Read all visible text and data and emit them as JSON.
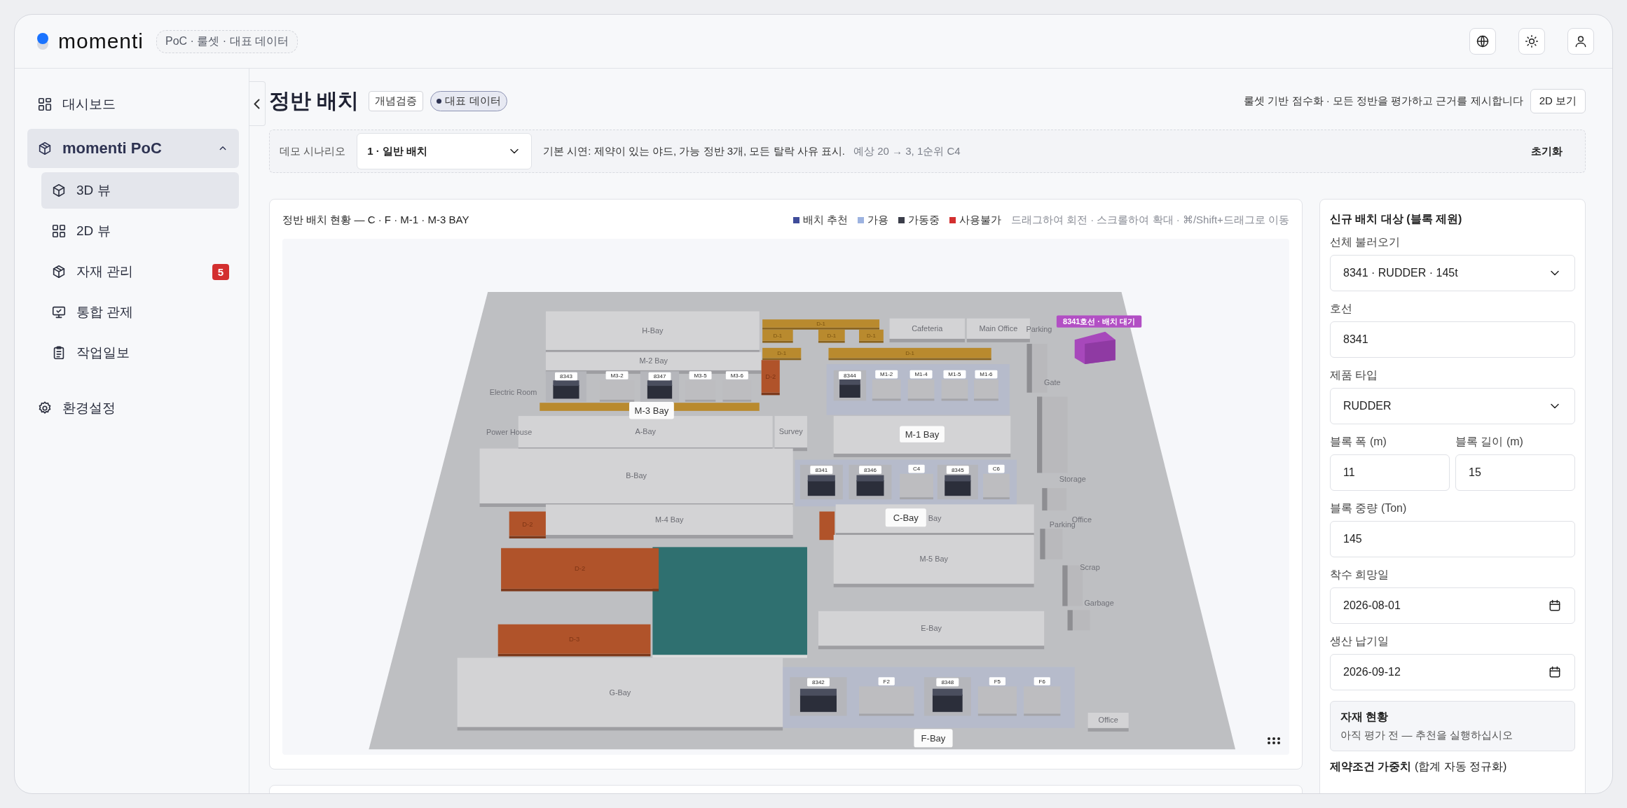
{
  "brand": {
    "name": "momenti",
    "tag": "PoC · 룰셋 · 대표 데이터"
  },
  "top_actions": [
    {
      "kind": "globe"
    },
    {
      "kind": "theme"
    },
    {
      "kind": "user"
    }
  ],
  "sidebar": {
    "items": [
      {
        "kind": "link",
        "label": "대시보드",
        "selected": false
      },
      {
        "kind": "group",
        "label": "momenti PoC",
        "expanded": true,
        "selected": true,
        "children": [
          {
            "label": "3D 뷰",
            "selected": true
          },
          {
            "label": "2D 뷰",
            "selected": false
          },
          {
            "label": "자재 관리",
            "selected": false,
            "badge": "5"
          },
          {
            "label": "통합 관제",
            "selected": false
          },
          {
            "label": "작업일보",
            "selected": false
          }
        ]
      },
      {
        "kind": "link",
        "label": "환경설정",
        "selected": false
      }
    ]
  },
  "page": {
    "title": "정반 배치",
    "tags": [
      {
        "kind": "plain",
        "label": "개념검증"
      },
      {
        "kind": "dot",
        "label": "대표 데이터"
      }
    ],
    "description": "룰셋 기반 점수화 · 모든 정반을 평가하고 근거를 제시합니다",
    "button": "2D 보기"
  },
  "scenario": {
    "label": "데모 시나리오",
    "value": "1 · 일반 배치",
    "description": "기본 시연: 제약이 있는 야드, 가능 정반 3개, 모든 탈락 사유 표시.",
    "expectation": "예상 20 → 3, 1순위 C4",
    "reset": "초기화"
  },
  "view": {
    "title": "정반 배치 현황 — C · F · M-1 · M-3 BAY",
    "legend": [
      {
        "label": "배치 추천",
        "color": "#3f4c9a"
      },
      {
        "label": "가용",
        "color": "#9db3e0"
      },
      {
        "label": "가동중",
        "color": "#3b3e4a"
      },
      {
        "label": "사용불가",
        "color": "#d32f2f"
      }
    ],
    "hint": "드래그하여 회전 · 스크롤하여 확대 · ⌘/Shift+드래그로 이동",
    "map": {
      "areas": [
        {
          "label": "H-Bay"
        },
        {
          "label": "D-1"
        },
        {
          "label": "D-1"
        },
        {
          "label": "D-1"
        },
        {
          "label": "D-1"
        },
        {
          "label": "Cafeteria"
        },
        {
          "label": "Main Office"
        },
        {
          "label": "Parking"
        },
        {
          "label": "M-2 Bay"
        },
        {
          "label": "D-1"
        },
        {
          "label": "D-1"
        },
        {
          "label": "D-2"
        },
        {
          "label": "Electric Room"
        },
        {
          "label": "Gate"
        },
        {
          "label": "M-3 Bay"
        },
        {
          "label": "Power House"
        },
        {
          "label": "A-Bay"
        },
        {
          "label": "Survey"
        },
        {
          "label": "M-1 Bay"
        },
        {
          "label": "B-Bay"
        },
        {
          "label": "Storage"
        },
        {
          "label": "D-2"
        },
        {
          "label": "M-4 Bay"
        },
        {
          "label": "C-Bay"
        },
        {
          "label": "Bay"
        },
        {
          "label": "Office"
        },
        {
          "label": "Parking"
        },
        {
          "label": "M-5 Bay"
        },
        {
          "label": "D-2"
        },
        {
          "label": "Scrap"
        },
        {
          "label": "Garbage"
        },
        {
          "label": "E-Bay"
        },
        {
          "label": "D-3"
        },
        {
          "label": "G-Bay"
        },
        {
          "label": "Office"
        },
        {
          "label": "F-Bay"
        }
      ],
      "slots": [
        {
          "kind": "occupied",
          "label": "8343"
        },
        {
          "kind": "free",
          "label": "M3-2"
        },
        {
          "kind": "occupied",
          "label": "8347"
        },
        {
          "kind": "free",
          "label": "M3-5"
        },
        {
          "kind": "free",
          "label": "M3-6"
        },
        {
          "kind": "occupied",
          "label": "8344"
        },
        {
          "kind": "free",
          "label": "M1-2"
        },
        {
          "kind": "free",
          "label": "M1-4"
        },
        {
          "kind": "free",
          "label": "M1-5"
        },
        {
          "kind": "free",
          "label": "M1-6"
        },
        {
          "kind": "occupied",
          "label": "8341"
        },
        {
          "kind": "occupied",
          "label": "8346"
        },
        {
          "kind": "free",
          "label": "C4"
        },
        {
          "kind": "occupied",
          "label": "8345"
        },
        {
          "kind": "free",
          "label": "C6"
        },
        {
          "kind": "occupied",
          "label": "8342"
        },
        {
          "kind": "free",
          "label": "F2"
        },
        {
          "kind": "occupied",
          "label": "8348"
        },
        {
          "kind": "free",
          "label": "F5"
        },
        {
          "kind": "free",
          "label": "F6"
        }
      ],
      "waiting": {
        "label": "8341호선 · 배치 대기"
      }
    }
  },
  "form": {
    "title": "신규 배치 대상 (블록 제원)",
    "fields": [
      {
        "kind": "select",
        "label": "선체 불러오기",
        "value": "8341 · RUDDER · 145t"
      },
      {
        "kind": "text",
        "label": "호선",
        "value": "8341"
      },
      {
        "kind": "select",
        "label": "제품 타입",
        "value": "RUDDER"
      },
      {
        "kind": "pair",
        "fields": [
          {
            "kind": "text",
            "label": "블록 폭 (m)",
            "value": "11"
          },
          {
            "kind": "text",
            "label": "블록 길이 (m)",
            "value": "15"
          }
        ]
      },
      {
        "kind": "text",
        "label": "블록 중량 (Ton)",
        "value": "145"
      },
      {
        "kind": "date",
        "label": "착수 희망일",
        "value": "2026-08-01"
      },
      {
        "kind": "date",
        "label": "생산 납기일",
        "value": "2026-09-12"
      }
    ],
    "material": {
      "title": "자재 현황",
      "text": "아직 평가 전 — 추천을 실행하십시오"
    },
    "weights": {
      "title": "**제약조건 가중치** (합계 자동 정규화)"
    }
  }
}
